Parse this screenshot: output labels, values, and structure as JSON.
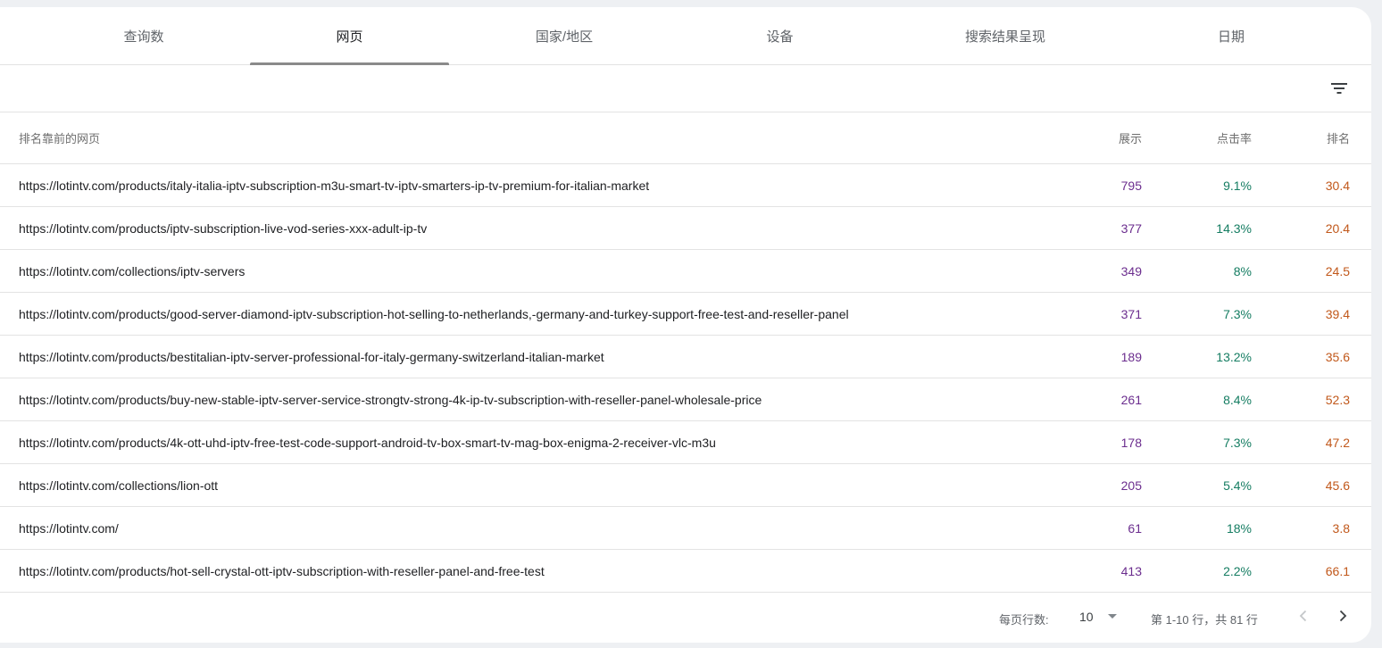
{
  "tabs": [
    {
      "label": "查询数",
      "active": false
    },
    {
      "label": "网页",
      "active": true
    },
    {
      "label": "国家/地区",
      "active": false
    },
    {
      "label": "设备",
      "active": false
    },
    {
      "label": "搜索结果呈现",
      "active": false
    },
    {
      "label": "日期",
      "active": false
    }
  ],
  "table": {
    "headers": {
      "page": "排名靠前的网页",
      "impressions": "展示",
      "ctr": "点击率",
      "position": "排名"
    },
    "rows": [
      {
        "url": "https://lotintv.com/products/italy-italia-iptv-subscription-m3u-smart-tv-iptv-smarters-ip-tv-premium-for-italian-market",
        "impressions": "795",
        "ctr": "9.1%",
        "position": "30.4"
      },
      {
        "url": "https://lotintv.com/products/iptv-subscription-live-vod-series-xxx-adult-ip-tv",
        "impressions": "377",
        "ctr": "14.3%",
        "position": "20.4"
      },
      {
        "url": "https://lotintv.com/collections/iptv-servers",
        "impressions": "349",
        "ctr": "8%",
        "position": "24.5"
      },
      {
        "url": "https://lotintv.com/products/good-server-diamond-iptv-subscription-hot-selling-to-netherlands,-germany-and-turkey-support-free-test-and-reseller-panel",
        "impressions": "371",
        "ctr": "7.3%",
        "position": "39.4"
      },
      {
        "url": "https://lotintv.com/products/bestitalian-iptv-server-professional-for-italy-germany-switzerland-italian-market",
        "impressions": "189",
        "ctr": "13.2%",
        "position": "35.6"
      },
      {
        "url": "https://lotintv.com/products/buy-new-stable-iptv-server-service-strongtv-strong-4k-ip-tv-subscription-with-reseller-panel-wholesale-price",
        "impressions": "261",
        "ctr": "8.4%",
        "position": "52.3"
      },
      {
        "url": "https://lotintv.com/products/4k-ott-uhd-iptv-free-test-code-support-android-tv-box-smart-tv-mag-box-enigma-2-receiver-vlc-m3u",
        "impressions": "178",
        "ctr": "7.3%",
        "position": "47.2"
      },
      {
        "url": "https://lotintv.com/collections/lion-ott",
        "impressions": "205",
        "ctr": "5.4%",
        "position": "45.6"
      },
      {
        "url": "https://lotintv.com/",
        "impressions": "61",
        "ctr": "18%",
        "position": "3.8"
      },
      {
        "url": "https://lotintv.com/products/hot-sell-crystal-ott-iptv-subscription-with-reseller-panel-and-free-test",
        "impressions": "413",
        "ctr": "2.2%",
        "position": "66.1"
      }
    ]
  },
  "pagination": {
    "rows_per_page_label": "每页行数:",
    "rows_per_page_value": "10",
    "range_text": "第 1-10 行，共 81 行"
  },
  "colors": {
    "impressions": "#6b2d8e",
    "ctr": "#157d62",
    "position": "#c1581b"
  },
  "icons": {
    "filter": "filter-icon",
    "dropdown": "arrow-drop-down-icon",
    "prev": "chevron-left-icon",
    "next": "chevron-right-icon"
  }
}
